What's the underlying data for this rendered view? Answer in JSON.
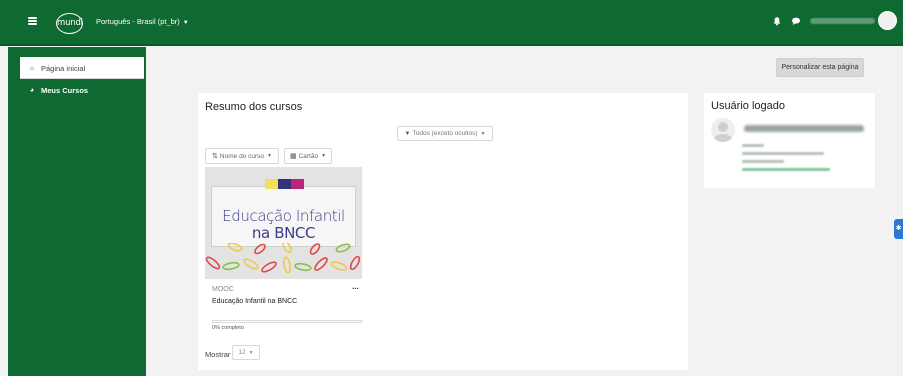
{
  "navbar": {
    "logo_text": "mundi",
    "language": "Português - Brasil (pt_br)",
    "notification_icon": "bell-icon",
    "message_icon": "chat-bubble-icon",
    "menu_icon": "hamburger-icon",
    "background_color": "#0e6a30"
  },
  "drawer": {
    "items": [
      {
        "label": "Página inicial",
        "icon": "home-icon"
      },
      {
        "label": "Meus Cursos",
        "icon": "dashboard-icon"
      }
    ]
  },
  "page": {
    "customize_button": "Personalizar esta página"
  },
  "courses_block": {
    "title": "Resumo dos cursos",
    "filter": "Todos (exceto ocultos)",
    "sort": "Nome do curso",
    "view": "Cartão",
    "course": {
      "image_line1": "Educação Infantil",
      "image_line2": "na BNCC",
      "category": "MOOC",
      "name": "Educação Infantil na BNCC",
      "progress_percent": 0,
      "progress_text": "0% completo",
      "menu": "..."
    },
    "show_label": "Mostrar",
    "show_value": "12"
  },
  "user_block": {
    "title": "Usuário logado"
  },
  "colors": {
    "brand_green": "#0e6a30",
    "link_blue": "#2a78d0"
  }
}
